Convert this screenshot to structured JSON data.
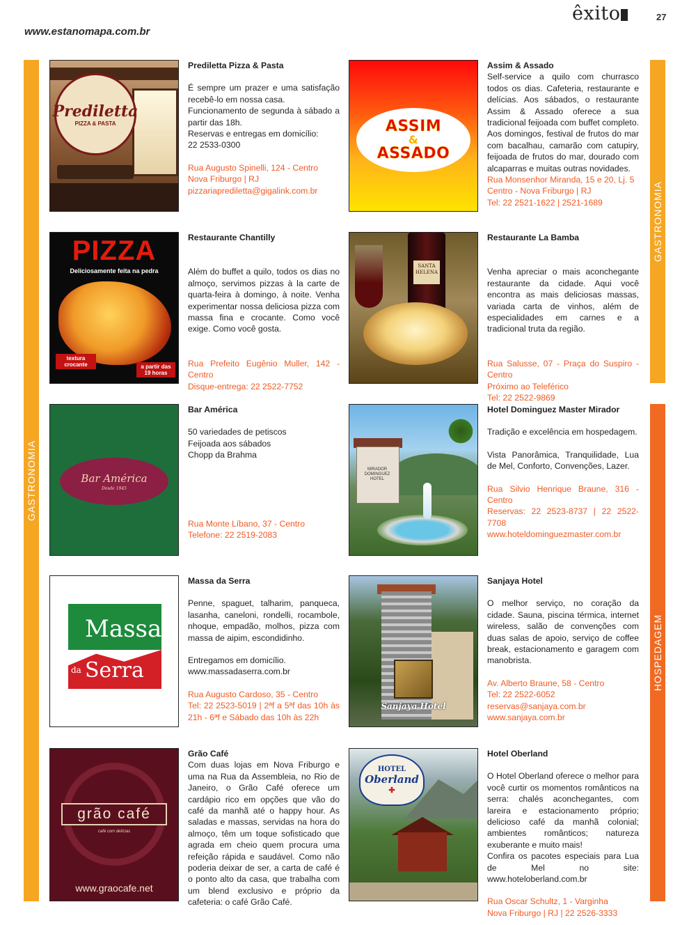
{
  "header": {
    "url": "www.estanomapa.com.br",
    "brand": "êxito",
    "page_number": "27"
  },
  "sidebars": {
    "left": "GASTRONOMIA",
    "right_top": "GASTRONOMIA",
    "right_bottom": "HOSPEDAGEM"
  },
  "colors": {
    "gastronomia": "#f5a623",
    "hospedagem": "#f06a22",
    "contact": "#f15a22"
  },
  "images": {
    "prediletta": {
      "logo": "Prediletta",
      "sub": "PIZZA & PASTA"
    },
    "assim": {
      "line1": "ASSIM",
      "amp": "&",
      "line2": "ASSADO"
    },
    "chantilly": {
      "title": "PIZZA",
      "subtitle": "Deliciosamente feita na pedra",
      "badge_left": "textura crocante",
      "badge_right": "a partir das 19 horas"
    },
    "labamba": {
      "bottle_label": "SANTA HELENA"
    },
    "bar": {
      "name": "Bar América",
      "since": "Desde 1945"
    },
    "mirador": {
      "sign": "MIRADOR DOMINGUEZ HOTEL"
    },
    "massa": {
      "word1": "Massa",
      "word2": "da",
      "word3": "Serra"
    },
    "sanjaya": {
      "name": "Sanjaya Hotel"
    },
    "grao": {
      "name": "grão café",
      "tagline": "café com delícias",
      "url": "www.graocafe.net"
    },
    "oberland": {
      "hotel": "HOTEL",
      "name": "Oberland",
      "mark": "✚"
    }
  },
  "entries": {
    "prediletta": {
      "title": "Prediletta Pizza & Pasta",
      "desc": "É sempre um prazer e uma satisfação recebê-lo em nossa casa.",
      "lines": [
        "Funcionamento de segunda à sábado a partir das 18h.",
        "Reservas e entregas em domicílio:",
        "22 2533-0300"
      ],
      "contact": [
        "Rua Augusto Spinelli, 124 - Centro",
        "Nova Friburgo | RJ",
        "pizzariaprediletta@gigalink.com.br"
      ]
    },
    "assim": {
      "title": "Assim & Assado",
      "desc": "Self-service a quilo com churrasco todos os dias. Cafeteria, restaurante e delícias. Aos sábados, o restaurante Assim & Assado oferece a sua tradicional feijoada com buffet completo. Aos domingos, festival de frutos do mar com bacalhau, camarão com catupiry, feijoada de frutos do mar, dourado com alcaparras e muitas outras novidades.",
      "contact": [
        "Rua Monsenhor Miranda, 15 e 20, Lj. 5",
        "Centro - Nova Friburgo | RJ",
        "Tel: 22 2521-1622 | 2521-1689"
      ]
    },
    "chantilly": {
      "title": "Restaurante Chantilly",
      "desc": "Além do buffet a quilo, todos os dias no almoço, servimos pizzas à la carte de quarta-feira à domingo, à noite. Venha experimentar nossa deliciosa pizza com massa fina e crocante. Como você exige. Como você gosta.",
      "contact": [
        "Rua Prefeito Eugênio Muller, 142 - Centro",
        "Disque-entrega: 22 2522-7752"
      ]
    },
    "labamba": {
      "title": "Restaurante La Bamba",
      "desc": "Venha apreciar o mais aconchegante restaurante da cidade. Aqui você encontra as mais deliciosas massas, variada carta de vinhos, além de especialidades em carnes e a tradicional truta da região.",
      "contact": [
        "Rua Salusse, 07 - Praça do Suspiro - Centro",
        "Próximo ao Teleférico",
        "Tel: 22 2522-9869"
      ]
    },
    "bar": {
      "title": "Bar América",
      "lines": [
        "50 variedades de petiscos",
        "Feijoada aos sábados",
        "Chopp da Brahma"
      ],
      "contact": [
        "Rua Monte Líbano, 37 - Centro",
        "Telefone: 22 2519-2083"
      ]
    },
    "mirador": {
      "title": "Hotel Dominguez Master Mirador",
      "desc": "Tradição e excelência em hospedagem.",
      "desc2": "Vista Panorâmica, Tranquilidade, Lua de Mel, Conforto, Convenções, Lazer.",
      "contact": [
        "Rua Silvio Henrique Braune, 316 - Centro",
        "Reservas: 22 2523-8737 | 22 2522-7708",
        "www.hoteldominguezmaster.com.br"
      ]
    },
    "massa": {
      "title": "Massa da Serra",
      "desc": "Penne, spaguet, talharim, panqueca, lasanha, caneloni, rondelli, rocambole, nhoque, empadão, molhos, pizza com massa de aipim, escondidinho.",
      "lines": [
        "Entregamos em domicílio.",
        "www.massadaserra.com.br"
      ],
      "contact": [
        "Rua Augusto Cardoso, 35 - Centro",
        "Tel: 22 2523-5019 | 2ªf a 5ªf das 10h às 21h - 6ªf e Sábado das 10h às 22h"
      ]
    },
    "sanjaya": {
      "title": "Sanjaya Hotel",
      "desc": "O melhor serviço, no coração da cidade. Sauna, piscina térmica, internet wireless, salão de convenções com duas salas de apoio, serviço de coffee break, estacionamento e garagem com manobrista.",
      "contact": [
        "Av. Alberto Braune, 58 - Centro",
        "Tel: 22 2522-6052",
        "reservas@sanjaya.com.br",
        "www.sanjaya.com.br"
      ]
    },
    "grao": {
      "title": "Grão Café",
      "desc": "Com duas lojas em Nova Friburgo e uma na Rua da Assembleia, no Rio de Janeiro, o Grão Café oferece um cardápio rico em opções que vão do café da manhã até o happy hour. As saladas e massas, servidas na hora do almoço, têm um toque sofisticado que agrada em cheio quem procura uma refeição rápida e saudável. Como não poderia deixar de ser, a carta de café é o ponto alto da casa, que trabalha com um blend exclusivo e próprio da cafeteria: o café Grão Café."
    },
    "oberland": {
      "title": "Hotel Oberland",
      "desc": "O Hotel Oberland oferece o melhor para você curtir os momentos românticos na serra: chalés aconchegantes, com lareira e estacionamento próprio; delicioso café da manhã colonial; ambientes românticos; natureza exuberante e muito mais!",
      "desc2": "Confira os pacotes especiais para Lua de Mel no site: www.hoteloberland.com.br",
      "contact": [
        "Rua Oscar Schultz, 1 - Varginha",
        "Nova Friburgo | RJ | 22 2526-3333"
      ]
    }
  }
}
